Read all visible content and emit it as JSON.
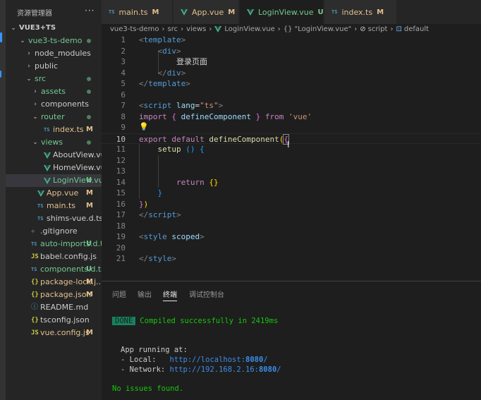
{
  "explorer": {
    "title": "资源管理器",
    "more": "···",
    "items": [
      {
        "name": "VUE3+TS",
        "kind": "root",
        "twisty": "⌄"
      },
      {
        "name": "vue3-ts-demo",
        "kind": "folder",
        "twisty": "⌄"
      },
      {
        "name": "node_modules",
        "kind": "folder",
        "twisty": "›"
      },
      {
        "name": "public",
        "kind": "folder",
        "twisty": "›"
      },
      {
        "name": "src",
        "kind": "folder",
        "twisty": "⌄"
      },
      {
        "name": "assets",
        "kind": "folder",
        "twisty": "›"
      },
      {
        "name": "components",
        "kind": "folder",
        "twisty": "›"
      },
      {
        "name": "router",
        "kind": "folder",
        "twisty": "⌄"
      },
      {
        "name": "index.ts",
        "kind": "ts",
        "icon": "TS",
        "badge": "M"
      },
      {
        "name": "views",
        "kind": "folder",
        "twisty": "⌄"
      },
      {
        "name": "AboutView.vue",
        "kind": "vue"
      },
      {
        "name": "HomeView.vue",
        "kind": "vue"
      },
      {
        "name": "LoginView.vue",
        "kind": "vue",
        "badge": "U"
      },
      {
        "name": "App.vue",
        "kind": "vue",
        "badge": "M"
      },
      {
        "name": "main.ts",
        "kind": "ts",
        "icon": "TS",
        "badge": "M"
      },
      {
        "name": "shims-vue.d.ts",
        "kind": "ts",
        "icon": "TS"
      },
      {
        "name": ".gitignore",
        "kind": "git",
        "icon": "◆"
      },
      {
        "name": "auto-imports.d.ts",
        "kind": "ts",
        "icon": "TS",
        "badge": "U"
      },
      {
        "name": "babel.config.js",
        "kind": "js",
        "icon": "JS"
      },
      {
        "name": "components.d.ts",
        "kind": "ts",
        "icon": "TS",
        "badge": "U"
      },
      {
        "name": "package-lock.j...",
        "kind": "json",
        "icon": "{}",
        "badge": "M"
      },
      {
        "name": "package.json",
        "kind": "json",
        "icon": "{}",
        "badge": "M"
      },
      {
        "name": "README.md",
        "kind": "md",
        "icon": "ⓘ"
      },
      {
        "name": "tsconfig.json",
        "kind": "json",
        "icon": "{}"
      },
      {
        "name": "vue.config.js",
        "kind": "js",
        "icon": "JS",
        "badge": "M"
      }
    ]
  },
  "tabs": [
    {
      "label": "main.ts",
      "kind": "ts",
      "icon": "TS",
      "mark": "M"
    },
    {
      "label": "App.vue",
      "kind": "vue",
      "mark": "M"
    },
    {
      "label": "LoginView.vue",
      "kind": "vue",
      "mark": "U",
      "close": "✕"
    },
    {
      "label": "index.ts",
      "kind": "ts",
      "icon": "TS",
      "mark": "M"
    }
  ],
  "breadcrumb": {
    "parts": [
      "vue3-ts-demo",
      "src",
      "views",
      "LoginView.vue",
      "{} \"LoginView.vue\"",
      "script",
      "default"
    ],
    "sep": "›"
  },
  "editor": {
    "line_numbers": [
      "1",
      "2",
      "3",
      "4",
      "5",
      "6",
      "7",
      "8",
      "9",
      "10",
      "11",
      "12",
      "13",
      "14",
      "15",
      "16",
      "17",
      "18",
      "19",
      "20",
      "21"
    ],
    "lines": [
      [
        [
          "<",
          "br"
        ],
        [
          "template",
          "tag"
        ],
        [
          ">",
          "br"
        ]
      ],
      [
        [
          "    ",
          "txt"
        ],
        [
          "<",
          "br"
        ],
        [
          "div",
          "tag"
        ],
        [
          ">",
          "br"
        ]
      ],
      [
        [
          "        登录页面",
          "txt"
        ]
      ],
      [
        [
          "    ",
          "txt"
        ],
        [
          "</",
          "br"
        ],
        [
          "div",
          "tag"
        ],
        [
          ">",
          "br"
        ]
      ],
      [
        [
          "</",
          "br"
        ],
        [
          "template",
          "tag"
        ],
        [
          ">",
          "br"
        ]
      ],
      [],
      [
        [
          "<",
          "br"
        ],
        [
          "script",
          "tag"
        ],
        [
          " ",
          "txt"
        ],
        [
          "lang",
          "attr"
        ],
        [
          "=",
          "txt"
        ],
        [
          "\"ts\"",
          "str"
        ],
        [
          ">",
          "br"
        ]
      ],
      [
        [
          "import",
          "kw"
        ],
        [
          " ",
          "txt"
        ],
        [
          "{",
          "b2"
        ],
        [
          " ",
          "txt"
        ],
        [
          "defineComponent",
          "var"
        ],
        [
          " ",
          "txt"
        ],
        [
          "}",
          "b2"
        ],
        [
          " ",
          "txt"
        ],
        [
          "from",
          "kw"
        ],
        [
          " ",
          "txt"
        ],
        [
          "'vue'",
          "str"
        ]
      ],
      [],
      [
        [
          "export",
          "kw"
        ],
        [
          " ",
          "txt"
        ],
        [
          "default",
          "kw"
        ],
        [
          " ",
          "txt"
        ],
        [
          "defineComponent",
          "fn"
        ],
        [
          "(",
          "b1"
        ],
        [
          "{",
          "b2"
        ]
      ],
      [
        [
          "    ",
          "txt"
        ],
        [
          "setup",
          "fn"
        ],
        [
          " ",
          "txt"
        ],
        [
          "()",
          "b3"
        ],
        [
          " ",
          "txt"
        ],
        [
          "{",
          "b3"
        ]
      ],
      [],
      [],
      [
        [
          "        ",
          "txt"
        ],
        [
          "return",
          "kw"
        ],
        [
          " ",
          "txt"
        ],
        [
          "{}",
          "b1"
        ]
      ],
      [
        [
          "    ",
          "txt"
        ],
        [
          "}",
          "b3"
        ]
      ],
      [
        [
          "}",
          "b2"
        ],
        [
          ")",
          "b1"
        ]
      ],
      [
        [
          "</",
          "br"
        ],
        [
          "script",
          "tag"
        ],
        [
          ">",
          "br"
        ]
      ],
      [],
      [
        [
          "<",
          "br"
        ],
        [
          "style",
          "tag"
        ],
        [
          " ",
          "txt"
        ],
        [
          "scoped",
          "attr"
        ],
        [
          ">",
          "br"
        ]
      ],
      [],
      [
        [
          "</",
          "br"
        ],
        [
          "style",
          "tag"
        ],
        [
          ">",
          "br"
        ]
      ]
    ],
    "bulb": "💡",
    "cursor": "I"
  },
  "panel": {
    "tabs": [
      "问题",
      "输出",
      "终端",
      "调试控制台"
    ],
    "done_label": "DONE",
    "compiled": "Compiled successfully in 2419ms",
    "app_running": "App running at:",
    "local_label": "- Local:   ",
    "local_url_pre": "http://localhost:",
    "local_port": "8080",
    "local_url_post": "/",
    "network_label": "- Network: ",
    "network_url_pre": "http://192.168.2.16:",
    "network_port": "8080",
    "network_url_post": "/",
    "no_issues": "No issues found."
  },
  "colors": {
    "modified": "#e2c08d",
    "untracked": "#73c991",
    "vue_green": "#41b883",
    "ts_blue": "#519aba"
  }
}
